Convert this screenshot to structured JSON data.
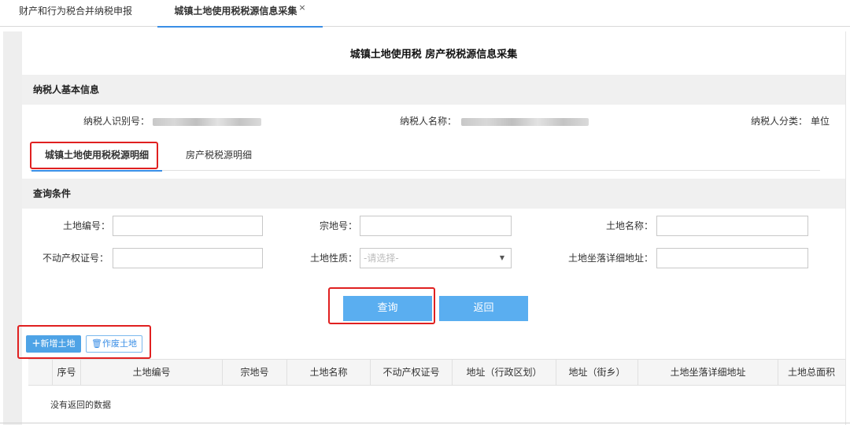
{
  "top_tabs": [
    {
      "label": "财产和行为税合并纳税申报"
    },
    {
      "label": "城镇土地使用税税源信息采集",
      "close": "×"
    }
  ],
  "page_title": "城镇土地使用税  房产税税源信息采集",
  "basic_info": {
    "section_title": "纳税人基本信息",
    "taxpayer_id_label": "纳税人识别号：",
    "taxpayer_name_label": "纳税人名称：",
    "taxpayer_category_label": "纳税人分类：",
    "taxpayer_category_value": "单位"
  },
  "sub_tabs": [
    {
      "label": "城镇土地使用税税源明细",
      "active": true
    },
    {
      "label": "房产税税源明细",
      "active": false
    }
  ],
  "query": {
    "section_title": "查询条件",
    "land_no_label": "土地编号：",
    "parcel_no_label": "宗地号：",
    "land_name_label": "土地名称：",
    "property_cert_label": "不动产权证号：",
    "land_nature_label": "土地性质：",
    "land_nature_placeholder": "-请选择-",
    "address_detail_label": "土地坐落详细地址：",
    "search_button": "查询",
    "back_button": "返回"
  },
  "actions": {
    "add_land": "新增土地",
    "void_land": "作废土地"
  },
  "table": {
    "columns": [
      "序号",
      "土地编号",
      "宗地号",
      "土地名称",
      "不动产权证号",
      "地址（行政区划）",
      "地址（街乡）",
      "土地坐落详细地址",
      "土地总面积"
    ],
    "empty_text": "没有返回的数据"
  },
  "colors": {
    "accent": "#3a8ee6",
    "button": "#5aaef0",
    "highlight_box": "#e02020"
  }
}
